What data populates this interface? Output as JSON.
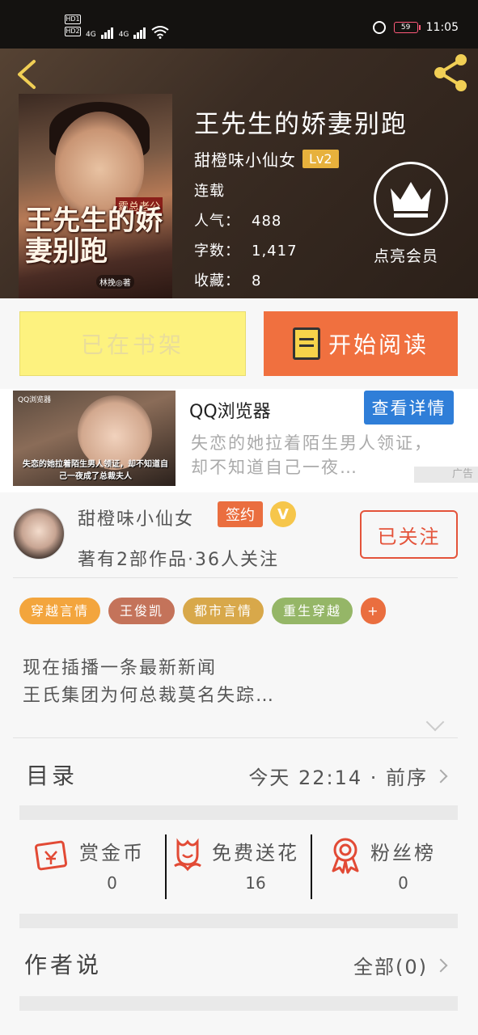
{
  "status_bar": {
    "hd1": "HD1",
    "hd2": "HD2",
    "net1": "4G",
    "net2": "4G",
    "battery": "59",
    "time": "11:05"
  },
  "book": {
    "cover_title": "王先生的娇妻别跑",
    "cover_subtitle": "霸总老公",
    "cover_author": "林挽◎著",
    "title": "王先生的娇妻别跑",
    "author": "甜橙味小仙女",
    "level": "Lv2",
    "status": "连载",
    "popularity_label": "人气：",
    "popularity": "488",
    "words_label": "字数：",
    "words": "1,417",
    "favorites_label": "收藏：",
    "favorites": "8",
    "vip_label": "点亮会员"
  },
  "actions": {
    "shelf": "已在书架",
    "read": "开始阅读"
  },
  "ad": {
    "logo": "QQ浏览器",
    "caption_line1": "失恋的她拉着陌生男人领证，却不知道自",
    "caption_line2": "己一夜成了总裁夫人",
    "title": "QQ浏览器",
    "button": "查看详情",
    "description": "失恋的她拉着陌生男人领证，却不知道自己一夜…",
    "tag": "广告"
  },
  "author_section": {
    "name": "甜橙味小仙女",
    "sign_badge": "签约",
    "v_badge": "V",
    "stats": "著有2部作品·36人关注",
    "follow": "已关注"
  },
  "tags": [
    {
      "label": "穿越言情",
      "color": "#f3a53d"
    },
    {
      "label": "王俊凯",
      "color": "#c4735a"
    },
    {
      "label": "都市言情",
      "color": "#d8a84a"
    },
    {
      "label": "重生穿越",
      "color": "#95b667"
    },
    {
      "label": "+",
      "color": "#ea6e3f"
    }
  ],
  "intro": {
    "line1": "现在插播一条最新新闻",
    "line2": "王氏集团为何总裁莫名失踪…"
  },
  "catalog": {
    "label": "目录",
    "latest": "今天 22:14 · 前序"
  },
  "stats": [
    {
      "label": "赏金币",
      "value": "0"
    },
    {
      "label": "免费送花",
      "value": "16"
    },
    {
      "label": "粉丝榜",
      "value": "0"
    }
  ],
  "author_says": {
    "label": "作者说",
    "all": "全部(0)"
  },
  "colors": {
    "accent": "#f0703f",
    "shelf_button": "#fdf27f",
    "follow": "#e4533a",
    "icon_red": "#e24a35"
  }
}
